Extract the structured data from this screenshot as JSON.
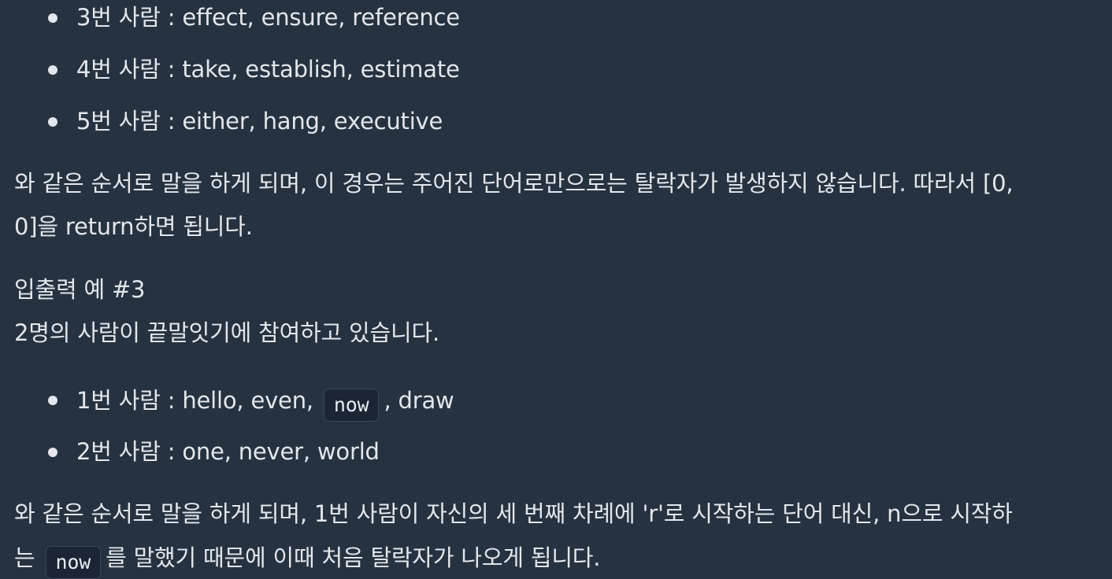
{
  "example2_list": [
    {
      "label": "3번 사람",
      "words": "effect, ensure, reference"
    },
    {
      "label": "4번 사람",
      "words": "take, establish, estimate"
    },
    {
      "label": "5번 사람",
      "words": "either, hang, executive"
    }
  ],
  "example2_explanation": {
    "line1": "와 같은 순서로 말을 하게 되며, 이 경우는 주어진 단어로만으로는 탈락자가 발생하지 않습니다. 따라서 [0,",
    "line2": "0]을 return하면 됩니다."
  },
  "example3": {
    "title": "입출력 예 #3",
    "intro": "2명의 사람이 끝말잇기에 참여하고 있습니다.",
    "person1_label": "1번 사람",
    "person1_words_before": "hello, even,",
    "person1_code": "now",
    "person1_words_after": ", draw",
    "person2_label": "2번 사람",
    "person2_words": "one, never, world",
    "explanation_line1": "와 같은 순서로 말을 하게 되며, 1번 사람이 자신의 세 번째 차례에 'r'로 시작하는 단어 대신, n으로 시작하",
    "explanation_line2_before": "는",
    "explanation_code": "now",
    "explanation_line2_after": "를 말했기 때문에 이때 처음 탈락자가 나오게 됩니다."
  },
  "separator": " : "
}
